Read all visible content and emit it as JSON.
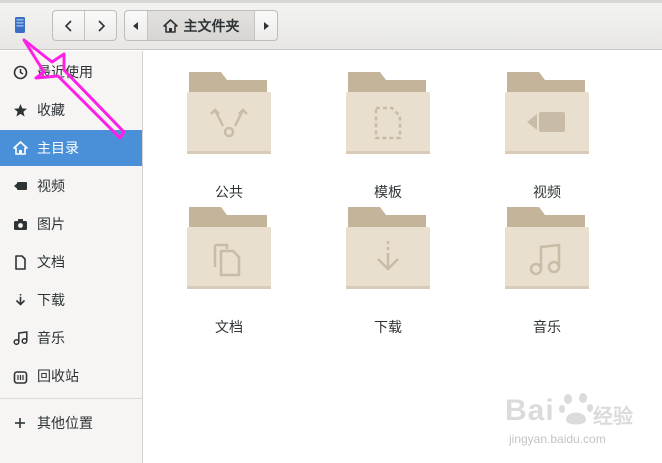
{
  "header": {
    "path_current": "主文件夹",
    "back_icon": "go-back-icon",
    "forward_icon": "go-forward-icon"
  },
  "sidebar": {
    "items": [
      {
        "label": "最近使用",
        "icon": "recent-clock-icon",
        "active": false
      },
      {
        "label": "收藏",
        "icon": "star-icon",
        "active": false
      },
      {
        "label": "主目录",
        "icon": "home-icon",
        "active": true
      },
      {
        "label": "视频",
        "icon": "video-icon",
        "active": false
      },
      {
        "label": "图片",
        "icon": "camera-icon",
        "active": false
      },
      {
        "label": "文档",
        "icon": "document-icon",
        "active": false
      },
      {
        "label": "下载",
        "icon": "download-icon",
        "active": false
      },
      {
        "label": "音乐",
        "icon": "music-icon",
        "active": false
      },
      {
        "label": "回收站",
        "icon": "trash-icon",
        "active": false
      }
    ],
    "other_locations": {
      "label": "其他位置",
      "icon": "plus-icon"
    }
  },
  "folders": [
    {
      "name": "公共",
      "emblem": "share-emblem-icon"
    },
    {
      "name": "模板",
      "emblem": "template-emblem-icon"
    },
    {
      "name": "视频",
      "emblem": "video-emblem-icon"
    },
    {
      "name": "文档",
      "emblem": "document-emblem-icon"
    },
    {
      "name": "下载",
      "emblem": "download-emblem-icon"
    },
    {
      "name": "音乐",
      "emblem": "music-emblem-icon"
    }
  ],
  "colors": {
    "accent": "#4a90d9",
    "folder_back": "#c4b49a",
    "folder_front": "#e9dfcf",
    "folder_emblem": "#c9bca6",
    "annotation": "#ff1fe6"
  },
  "watermark": {
    "brand": "Bai",
    "brand_cn": "经验",
    "url": "jingyan.baidu.com"
  }
}
